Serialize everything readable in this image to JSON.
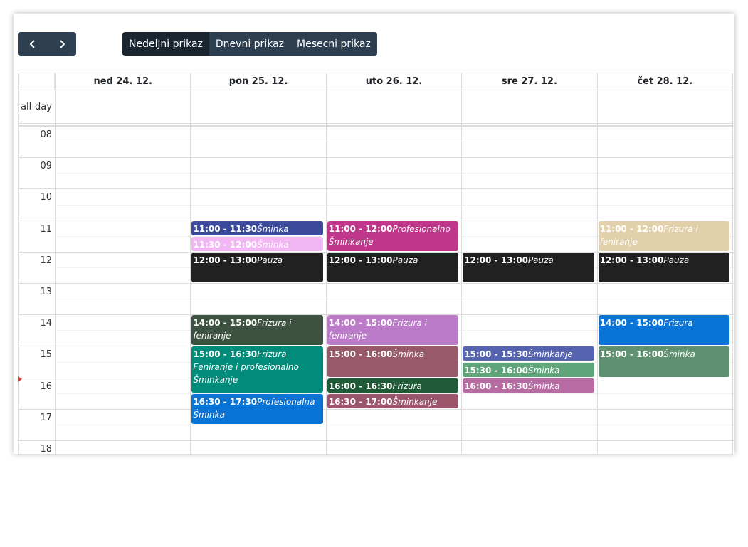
{
  "toolbar": {
    "prev_icon": "chevron-left-icon",
    "next_icon": "chevron-right-icon",
    "views": [
      "Nedeljni prikaz",
      "Dnevni prikaz",
      "Mesecni prikaz"
    ],
    "active_view": "Nedeljni prikaz"
  },
  "calendar": {
    "allday_label": "all-day",
    "days": [
      "ned 24. 12.",
      "pon 25. 12.",
      "uto 26. 12.",
      "sre 27. 12.",
      "čet 28. 12."
    ],
    "hours": [
      "08",
      "09",
      "10",
      "11",
      "12",
      "13",
      "14",
      "15",
      "16",
      "17",
      "18"
    ],
    "events": [
      {
        "day": 1,
        "start": "11:00",
        "end": "11:30",
        "time": "11:00 - 11:30",
        "name": "Šminka",
        "color": "#3b4a9a",
        "text": "#ffffff"
      },
      {
        "day": 1,
        "start": "11:30",
        "end": "12:00",
        "time": "11:30 - 12:00",
        "name": "Šminka",
        "color": "#f2b6f4",
        "text": "#ffffff"
      },
      {
        "day": 1,
        "start": "12:00",
        "end": "13:00",
        "time": "12:00 - 13:00",
        "name": "Pauza",
        "color": "#212121",
        "text": "#ffffff"
      },
      {
        "day": 1,
        "start": "14:00",
        "end": "15:00",
        "time": "14:00 - 15:00",
        "name": "Frizura i feniranje",
        "color": "#3d5240",
        "text": "#ffffff"
      },
      {
        "day": 1,
        "start": "15:00",
        "end": "16:30",
        "time": "15:00 - 16:30",
        "name": "Frizura Feniranje i profesionalno Šminkanje",
        "color": "#008b7a",
        "text": "#ffffff"
      },
      {
        "day": 1,
        "start": "16:30",
        "end": "17:30",
        "time": "16:30 - 17:30",
        "name": "Profesionalna Šminka",
        "color": "#0a74d6",
        "text": "#ffffff"
      },
      {
        "day": 2,
        "start": "11:00",
        "end": "12:00",
        "time": "11:00 - 12:00",
        "name": "Profesionalno Šminkanje",
        "color": "#c0368a",
        "text": "#ffffff"
      },
      {
        "day": 2,
        "start": "12:00",
        "end": "13:00",
        "time": "12:00 - 13:00",
        "name": "Pauza",
        "color": "#212121",
        "text": "#ffffff"
      },
      {
        "day": 2,
        "start": "14:00",
        "end": "15:00",
        "time": "14:00 - 15:00",
        "name": "Frizura i feniranje",
        "color": "#bb7bc8",
        "text": "#ffffff"
      },
      {
        "day": 2,
        "start": "15:00",
        "end": "16:00",
        "time": "15:00 - 16:00",
        "name": "Šminka",
        "color": "#98596a",
        "text": "#ffffff"
      },
      {
        "day": 2,
        "start": "16:00",
        "end": "16:30",
        "time": "16:00 - 16:30",
        "name": "Frizura",
        "color": "#1f5a36",
        "text": "#ffffff"
      },
      {
        "day": 2,
        "start": "16:30",
        "end": "17:00",
        "time": "16:30 - 17:00",
        "name": "Šminkanje",
        "color": "#9c566b",
        "text": "#ffffff"
      },
      {
        "day": 3,
        "start": "12:00",
        "end": "13:00",
        "time": "12:00 - 13:00",
        "name": "Pauza",
        "color": "#212121",
        "text": "#ffffff"
      },
      {
        "day": 3,
        "start": "15:00",
        "end": "15:30",
        "time": "15:00 - 15:30",
        "name": "Šminkanje",
        "color": "#5563b0",
        "text": "#ffffff"
      },
      {
        "day": 3,
        "start": "15:30",
        "end": "16:00",
        "time": "15:30 - 16:00",
        "name": "Šminka",
        "color": "#60a47a",
        "text": "#ffffff"
      },
      {
        "day": 3,
        "start": "16:00",
        "end": "16:30",
        "time": "16:00 - 16:30",
        "name": "Šminka",
        "color": "#b66ca2",
        "text": "#ffffff"
      },
      {
        "day": 4,
        "start": "11:00",
        "end": "12:00",
        "time": "11:00 - 12:00",
        "name": "Frizura i feniranje",
        "color": "#e2d0aa",
        "text": "#ffffff"
      },
      {
        "day": 4,
        "start": "12:00",
        "end": "13:00",
        "time": "12:00 - 13:00",
        "name": "Pauza",
        "color": "#212121",
        "text": "#ffffff"
      },
      {
        "day": 4,
        "start": "14:00",
        "end": "15:00",
        "time": "14:00 - 15:00",
        "name": "Frizura",
        "color": "#0a74d6",
        "text": "#ffffff"
      },
      {
        "day": 4,
        "start": "15:00",
        "end": "16:00",
        "time": "15:00 - 16:00",
        "name": "Šminka",
        "color": "#5f9070",
        "text": "#ffffff"
      }
    ]
  }
}
